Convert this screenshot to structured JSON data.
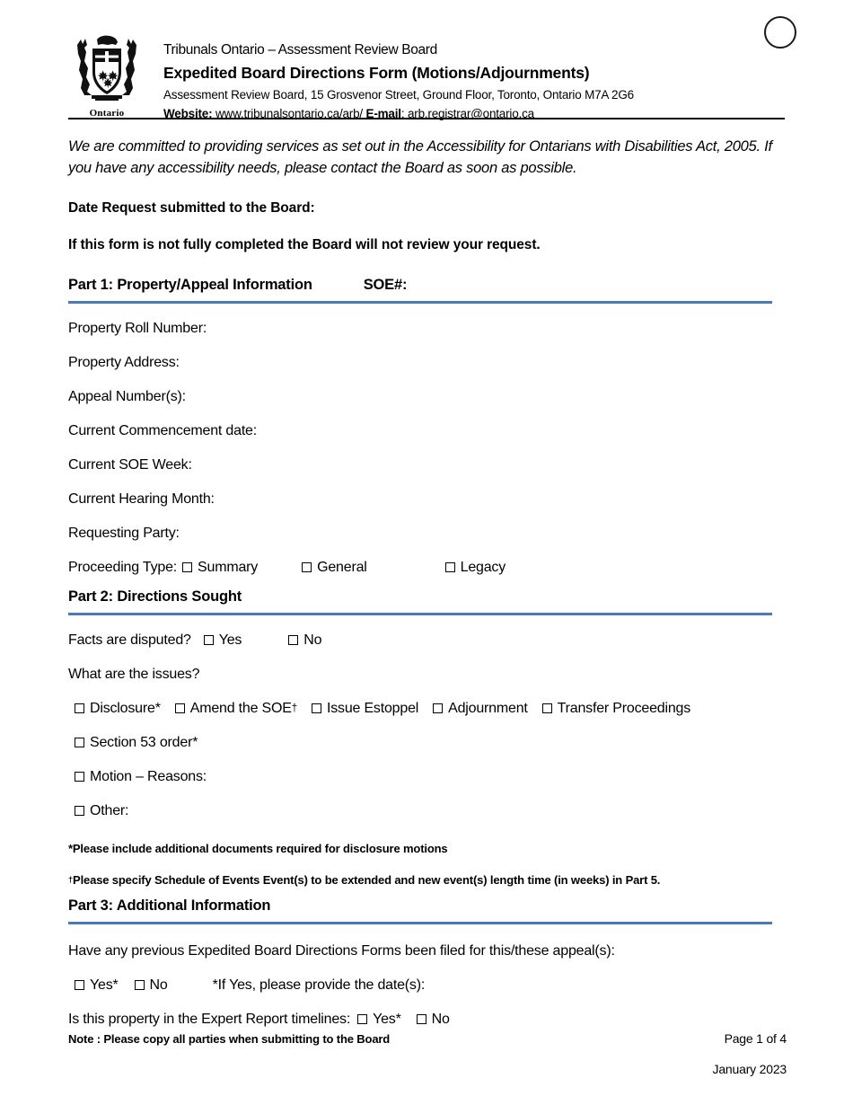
{
  "header": {
    "crest_label": "Ontario",
    "org_line": "Tribunals Ontario – Assessment Review Board",
    "form_title": "Expedited Board Directions Form (Motions/Adjournments)",
    "address_line": "Assessment Review Board, 15 Grosvenor Street, Ground Floor, Toronto, Ontario M7A 2G6",
    "website_label": "Website:",
    "website_value": "www.tribunalsontario.ca/arb/",
    "email_label": "E-mail",
    "email_value": ": arb.registrar@ontario.ca"
  },
  "intro": {
    "accessibility_statement": "We are committed to providing services as set out in the Accessibility for Ontarians with Disabilities Act, 2005. If you have any accessibility needs, please contact the Board as soon as possible.",
    "date_request_label": "Date Request submitted to the Board:",
    "completion_warning": "If this form is not fully completed the Board will not review your request."
  },
  "part1": {
    "heading": "Part 1: Property/Appeal Information",
    "soe_label": "SOE#:",
    "fields": [
      "Property Roll Number:",
      "Property Address:",
      "Appeal Number(s):",
      "Current Commencement date:",
      "Current SOE Week:",
      "Current Hearing Month:",
      "Requesting Party:"
    ],
    "proceeding_type_label": "Proceeding Type:",
    "proceeding_options": [
      "Summary",
      "General",
      "Legacy"
    ]
  },
  "part2": {
    "heading": "Part 2: Directions Sought",
    "facts_disputed_label": "Facts are disputed?",
    "facts_options": [
      "Yes",
      "No"
    ],
    "issues_question": "What are the issues?",
    "issues_row": [
      "Disclosure*",
      "Amend the SOE",
      "Issue Estoppel",
      "Adjournment",
      "Transfer Proceedings"
    ],
    "amend_soe_marker": "†",
    "section53": "Section 53 order*",
    "motion": "Motion – Reasons:",
    "other": "Other:",
    "footnote_star": "*Please include additional documents required for disclosure motions",
    "footnote_dagger_marker": "†",
    "footnote_dagger": "Please specify Schedule of Events Event(s) to be extended and new event(s) length time (in weeks) in Part 5."
  },
  "part3": {
    "heading": "Part 3: Additional Information",
    "previous_forms_question": "Have any previous Expedited Board Directions Forms been filed for this/these appeal(s):",
    "previous_options": [
      "Yes*",
      "No"
    ],
    "if_yes_label": "*If Yes, please provide the date(s):",
    "expert_report_label": "Is this property in the Expert Report timelines:",
    "expert_options": [
      "Yes*",
      "No"
    ]
  },
  "footer": {
    "note": "Note : Please copy all parties when submitting to the Board",
    "page": "Page 1 of 4",
    "date": "January 2023"
  },
  "colors": {
    "rule_blue": "#4a7ab5",
    "rule_black": "#000000",
    "text": "#000000"
  }
}
